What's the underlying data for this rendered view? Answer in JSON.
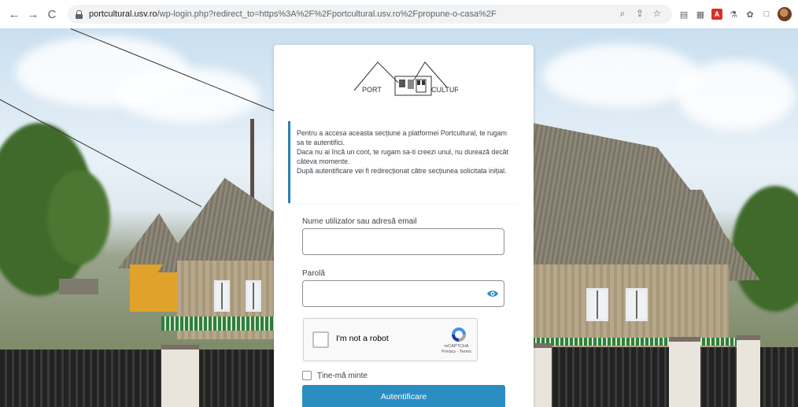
{
  "browser": {
    "url_host": "portcultural.usv.ro",
    "url_rest": "/wp-login.php?redirect_to=https%3A%2F%2Fportcultural.usv.ro%2Fpropune-o-casa%2F",
    "nav": {
      "back": "←",
      "forward": "→",
      "reload": "C"
    },
    "omni_icons": [
      "zoom-icon",
      "share-icon",
      "star-icon"
    ],
    "extensions": [
      "reader-icon",
      "grid-icon",
      "pdf-icon",
      "ext-icon",
      "puzzle-icon",
      "sidepanel-icon",
      "profile-avatar"
    ],
    "pdf_label": "A"
  },
  "logo": {
    "left_text": "PORT",
    "right_text": "CULTURAL"
  },
  "notice": {
    "line1": "Pentru a accesa aceasta secțiune a platformei Portcultural, te rugam sa te autentifici.",
    "line2": "Daca nu ai încă un cont, te rugam sa-ti creezi unul, nu durează decât câteva momente.",
    "line3": "După autentificare vei fi redirecționat către secțiunea solicitata inițial."
  },
  "form": {
    "username_label": "Nume utilizator sau adresă email",
    "username_value": "",
    "password_label": "Parolă",
    "password_value": "",
    "recaptcha_label": "I'm not a robot",
    "recaptcha_brand": "reCAPTCHA",
    "recaptcha_links": "Privacy - Terms",
    "remember_label": "Ține-mă minte",
    "submit_label": "Autentificare"
  },
  "colors": {
    "accent": "#2a8ec3",
    "notice_border": "#2a7fb9"
  }
}
